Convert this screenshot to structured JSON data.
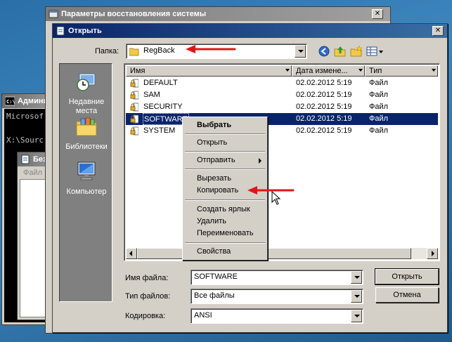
{
  "console_window": {
    "title": "Админис",
    "lines": [
      "Microsof",
      "",
      "X:\\Sourc"
    ]
  },
  "notepad_window": {
    "title": "Безы",
    "menu": "Файл  Г"
  },
  "restore_dialog": {
    "title": "Параметры восстановления системы",
    "close_label": "✕"
  },
  "open_dialog": {
    "title": "Открыть",
    "close_label": "✕",
    "folder_label": "Папка:",
    "folder_value": "RegBack",
    "places": [
      {
        "label": "Недавние места",
        "icon": "recent-places-icon"
      },
      {
        "label": "Библиотеки",
        "icon": "libraries-icon"
      },
      {
        "label": "Компьютер",
        "icon": "computer-icon"
      }
    ],
    "columns": [
      "Имя",
      "Дата измене...",
      "Тип"
    ],
    "files": [
      {
        "name": "DEFAULT",
        "date": "02.02.2012 5:19",
        "type": "Файл"
      },
      {
        "name": "SAM",
        "date": "02.02.2012 5:19",
        "type": "Файл"
      },
      {
        "name": "SECURITY",
        "date": "02.02.2012 5:19",
        "type": "Файл"
      },
      {
        "name": "SOFTWARE",
        "date": "02.02.2012 5:19",
        "type": "Файл"
      },
      {
        "name": "SYSTEM",
        "date": "02.02.2012 5:19",
        "type": "Файл"
      }
    ],
    "selected_index": 3,
    "filename_label": "Имя файла:",
    "filename_value": "SOFTWARE",
    "filetype_label": "Тип файлов:",
    "filetype_value": "Все файлы",
    "encoding_label": "Кодировка:",
    "encoding_value": "ANSI",
    "open_button": "Открыть",
    "cancel_button": "Отмена"
  },
  "context_menu": {
    "items": [
      {
        "label": "Выбрать",
        "bold": true
      },
      {
        "label": "Открыть"
      },
      {
        "label": "Отправить",
        "submenu": true
      },
      {
        "label": "Вырезать"
      },
      {
        "label": "Копировать"
      },
      {
        "label": "Создать ярлык"
      },
      {
        "label": "Удалить"
      },
      {
        "label": "Переименовать"
      },
      {
        "label": "Свойства"
      }
    ]
  },
  "colors": {
    "title_active": "#0a246a",
    "selection": "#0a246a",
    "annotation_arrow": "#e0151a",
    "face": "#d4d0c8"
  }
}
